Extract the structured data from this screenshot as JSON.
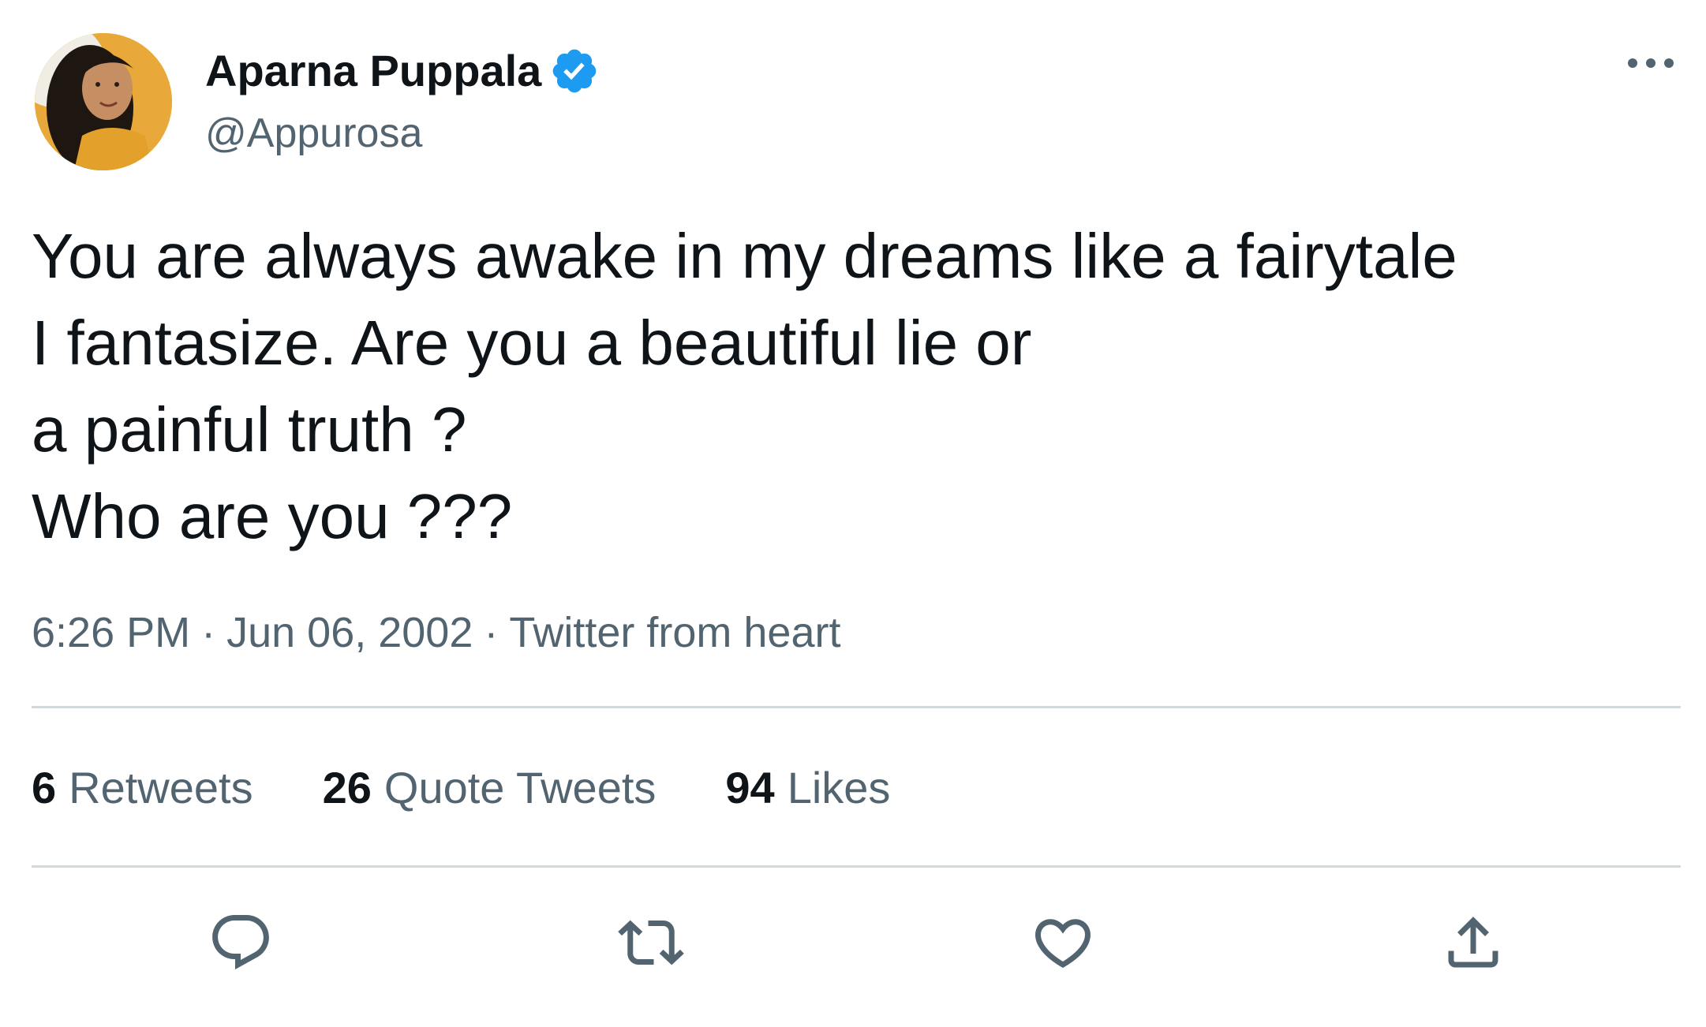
{
  "author": {
    "display_name": "Aparna Puppala",
    "handle": "@Appurosa",
    "verified": true
  },
  "tweet": {
    "lines": [
      "You are always awake in my dreams like a fairytale",
      "I fantasize. Are you a beautiful lie or",
      "a painful truth ?",
      "Who are you ???"
    ]
  },
  "meta": {
    "time": "6:26 PM",
    "date": "Jun 06, 2002",
    "source": "Twitter from heart",
    "separator": "·"
  },
  "stats": {
    "retweets": {
      "count": "6",
      "label": "Retweets"
    },
    "quote_tweets": {
      "count": "26",
      "label": "Quote Tweets"
    },
    "likes": {
      "count": "94",
      "label": "Likes"
    }
  },
  "icons": {
    "more": "more-icon",
    "reply": "reply-icon",
    "retweet": "retweet-icon",
    "like": "heart-icon",
    "share": "share-icon",
    "verified": "verified-badge-icon"
  },
  "colors": {
    "text_primary": "#0f1419",
    "text_secondary": "#536471",
    "verified_blue": "#1d9bf0",
    "divider": "#cfd9de"
  }
}
